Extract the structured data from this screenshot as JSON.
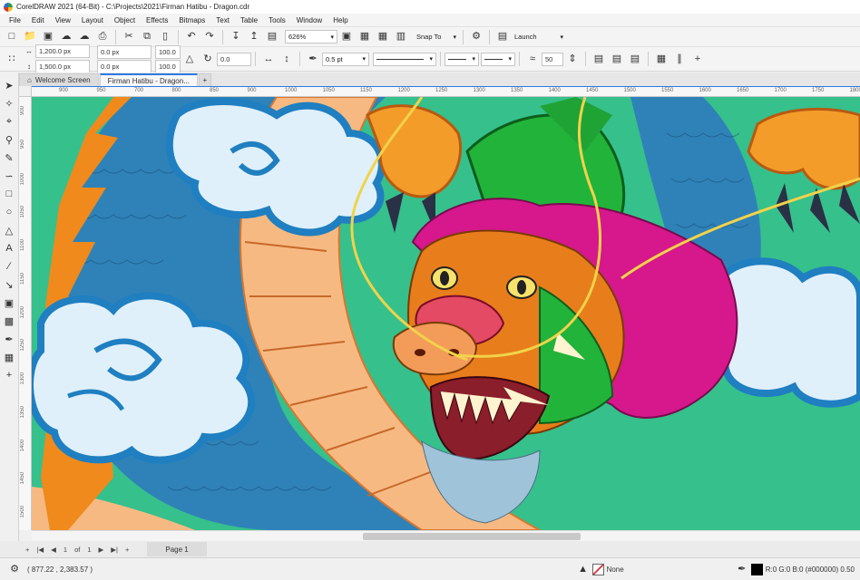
{
  "window": {
    "title": "CorelDRAW 2021 (64-Bit) - C:\\Projects\\2021\\Firman Hatibu - Dragon.cdr"
  },
  "menu": [
    "File",
    "Edit",
    "View",
    "Layout",
    "Object",
    "Effects",
    "Bitmaps",
    "Text",
    "Table",
    "Tools",
    "Window",
    "Help"
  ],
  "standard_toolbar": {
    "zoom": "626%",
    "snap_to": "Snap To",
    "launch": "Launch"
  },
  "property_bar": {
    "width": "1,200.0 px",
    "height": "1,500.0 px",
    "x": "0.0 px",
    "y": "0.0 px",
    "scale_w": "100.0",
    "scale_h": "100.0",
    "angle": "0.0",
    "outline_width": "0.5 pt",
    "curve_smoothing": "50"
  },
  "tabs": [
    "Welcome Screen",
    "Firman Hatibu - Dragon..."
  ],
  "hruler_ticks": [
    "900",
    "950",
    "700",
    "800",
    "850",
    "900",
    "1000",
    "1050",
    "1150",
    "1200",
    "1250",
    "1300",
    "1350",
    "1400",
    "1450",
    "1500",
    "1550",
    "1600",
    "1650",
    "1700",
    "1750",
    "1800"
  ],
  "vruler_ticks": [
    "900",
    "950",
    "1000",
    "1050",
    "1100",
    "1150",
    "1200",
    "1250",
    "1300",
    "1350",
    "1400",
    "1450",
    "1500"
  ],
  "pager": {
    "current": "1",
    "of": "of",
    "total": "1",
    "page_tab": "Page 1"
  },
  "status": {
    "coords": "( 877.22 , 2,383.57 )",
    "fill": "None",
    "outline": "R:0 G:0 B:0 (#000000)  0.50"
  },
  "colors": {
    "background": "#36c08c",
    "dragon_scales": "#2f82b8",
    "dragon_belly": "#f7b982",
    "cloud": "#dff0fb",
    "cloud_outline": "#1f7fc0",
    "horns": "#22b33a",
    "mane": "#d6188c",
    "whiskers": "#f1d34a"
  }
}
